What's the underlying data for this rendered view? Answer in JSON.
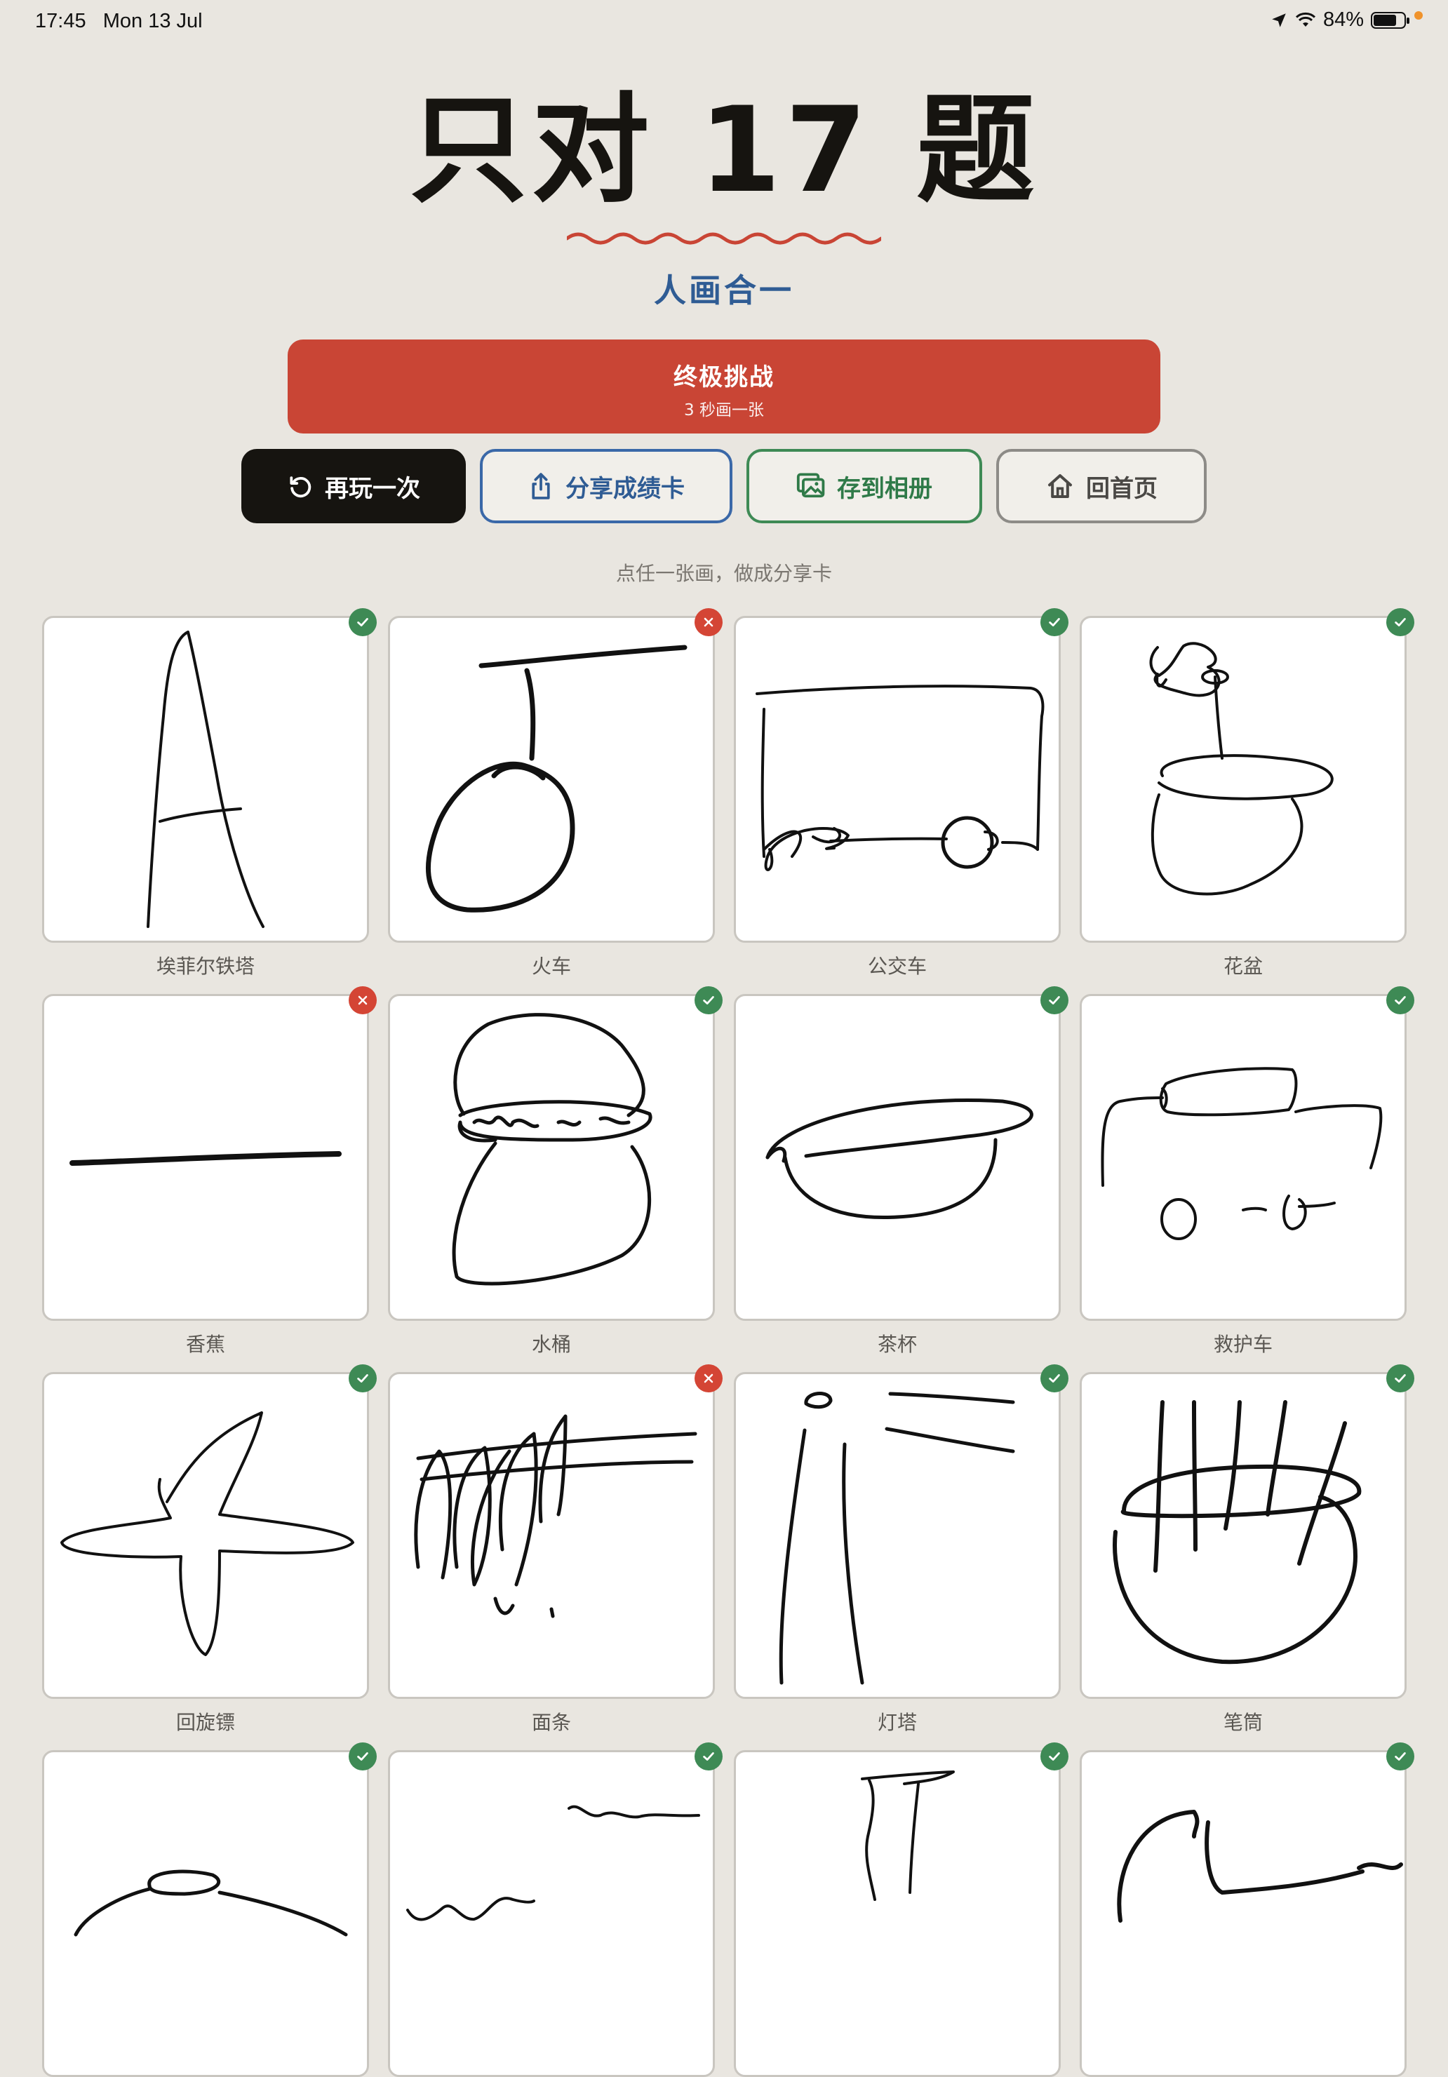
{
  "status_bar": {
    "time": "17:45",
    "date": "Mon 13 Jul",
    "battery": "84%"
  },
  "header": {
    "title": "只对 17 题",
    "subtitle": "人画合一"
  },
  "challenge_button": {
    "label": "终极挑战",
    "sublabel": "3 秒画一张"
  },
  "actions": {
    "replay": "再玩一次",
    "share": "分享成绩卡",
    "save": "存到相册",
    "home": "回首页"
  },
  "hint": "点任一张画，做成分享卡",
  "drawings": [
    {
      "label": "埃菲尔铁塔",
      "correct": true
    },
    {
      "label": "火车",
      "correct": false
    },
    {
      "label": "公交车",
      "correct": true
    },
    {
      "label": "花盆",
      "correct": true
    },
    {
      "label": "香蕉",
      "correct": false
    },
    {
      "label": "水桶",
      "correct": true
    },
    {
      "label": "茶杯",
      "correct": true
    },
    {
      "label": "救护车",
      "correct": true
    },
    {
      "label": "回旋镖",
      "correct": true
    },
    {
      "label": "面条",
      "correct": false
    },
    {
      "label": "灯塔",
      "correct": true
    },
    {
      "label": "笔筒",
      "correct": true
    },
    {
      "label": "",
      "correct": true
    },
    {
      "label": "",
      "correct": true
    },
    {
      "label": "",
      "correct": true
    },
    {
      "label": "",
      "correct": true
    }
  ]
}
